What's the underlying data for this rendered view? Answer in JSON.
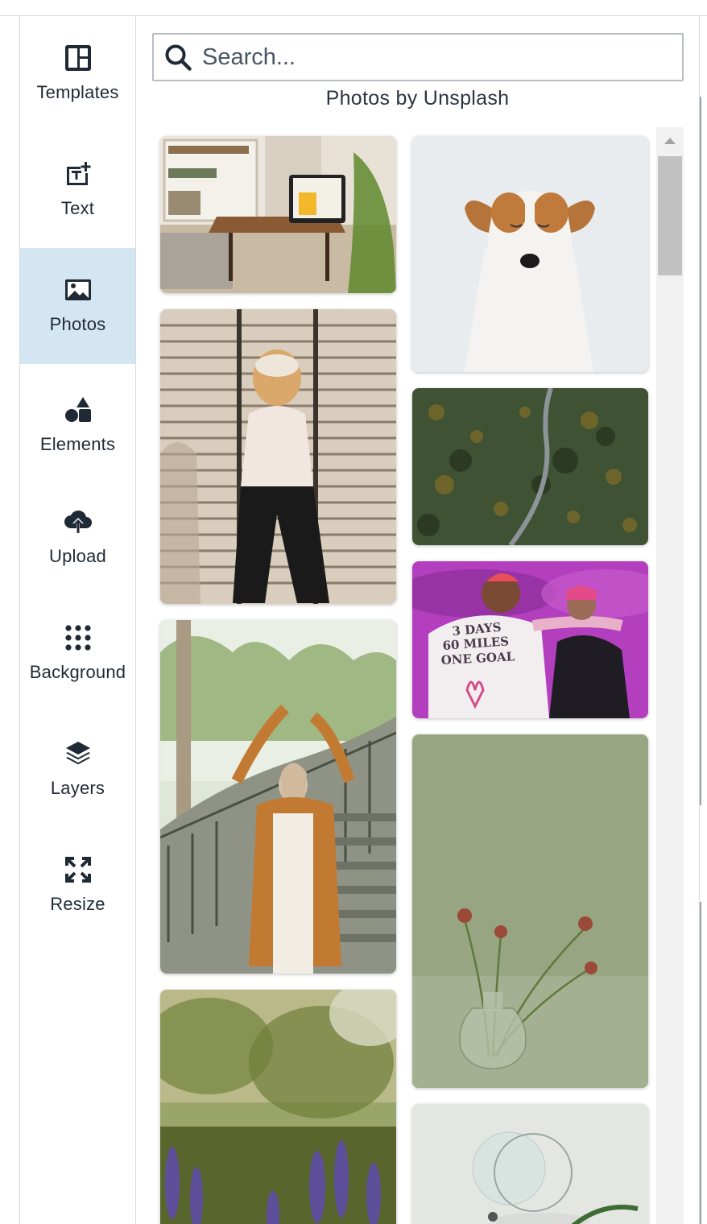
{
  "sidebar": {
    "items": [
      {
        "label": "Templates",
        "icon": "layout-template-icon",
        "active": false
      },
      {
        "label": "Text",
        "icon": "text-add-icon",
        "active": false
      },
      {
        "label": "Photos",
        "icon": "image-icon",
        "active": true
      },
      {
        "label": "Elements",
        "icon": "shapes-icon",
        "active": false
      },
      {
        "label": "Upload",
        "icon": "cloud-upload-icon",
        "active": false
      },
      {
        "label": "Background",
        "icon": "dots-grid-icon",
        "active": false
      },
      {
        "label": "Layers",
        "icon": "layers-icon",
        "active": false
      },
      {
        "label": "Resize",
        "icon": "resize-arrows-icon",
        "active": false
      }
    ]
  },
  "search": {
    "placeholder": "Search...",
    "value": ""
  },
  "panel": {
    "caption": "Photos by Unsplash"
  },
  "photos": {
    "left_column": [
      {
        "subject": "desk-tablet-living-room"
      },
      {
        "subject": "woman-curly-hair-hat"
      },
      {
        "subject": "woman-hijab-stairs"
      },
      {
        "subject": "purple-lupine-flowers"
      }
    ],
    "right_column": [
      {
        "subject": "jack-russell-dog"
      },
      {
        "subject": "aerial-forest-road"
      },
      {
        "subject": "pink-walk-hug"
      },
      {
        "subject": "dried-flowers-vase"
      },
      {
        "subject": "glass-spheres-ferns"
      }
    ]
  },
  "colors": {
    "accent_active": "#d4e6f2",
    "text_primary": "#1f2a36",
    "scroll_thumb": "#c1c1c1"
  }
}
